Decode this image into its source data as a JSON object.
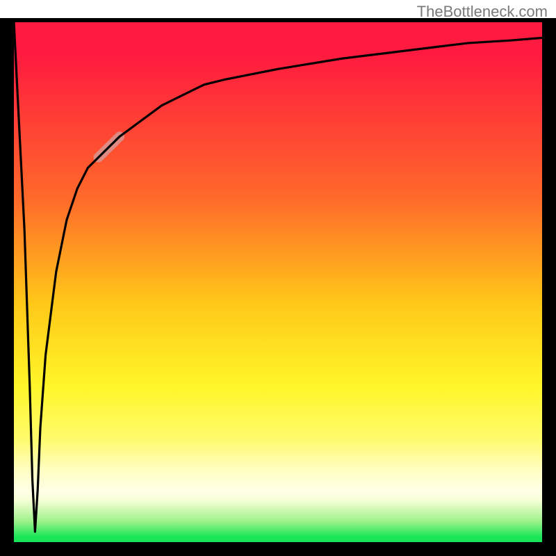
{
  "watermark": "TheBottleneck.com",
  "colors": {
    "bg_top": "#ff1a3f",
    "bg_bottom": "#19e657",
    "frame": "#000000",
    "curve": "#000000",
    "highlight": "rgba(210,160,160,0.75)"
  },
  "chart_data": {
    "type": "line",
    "title": "",
    "xlabel": "",
    "ylabel": "",
    "xlim": [
      0,
      100
    ],
    "ylim": [
      0,
      100
    ],
    "grid": false,
    "legend": false,
    "notes": "Values estimated from pixel positions on an unlabeled plot; y runs 0 (bottom, green) to 100 (top, red). Curve is a single black line with a steep near-vertical drop from top-left to a narrow valley near x≈4, then a rapid rise that asymptotically flattens near y≈97 at the right edge. A short semi-transparent pinkish highlight strip overlays the curve between roughly x≈15 and x≈22.",
    "series": [
      {
        "name": "curve",
        "x": [
          0,
          2,
          3,
          3.5,
          4,
          4.5,
          5,
          6,
          8,
          10,
          12,
          14,
          16,
          18,
          20,
          24,
          28,
          32,
          36,
          40,
          45,
          50,
          56,
          62,
          70,
          78,
          86,
          94,
          100
        ],
        "y": [
          100,
          60,
          30,
          12,
          2,
          10,
          22,
          36,
          52,
          62,
          68,
          72,
          74,
          76,
          78,
          81,
          84,
          86,
          88,
          89,
          90,
          91,
          92,
          93,
          94,
          95,
          96,
          96.5,
          97
        ]
      }
    ],
    "highlight_range_x": [
      15,
      22
    ]
  }
}
